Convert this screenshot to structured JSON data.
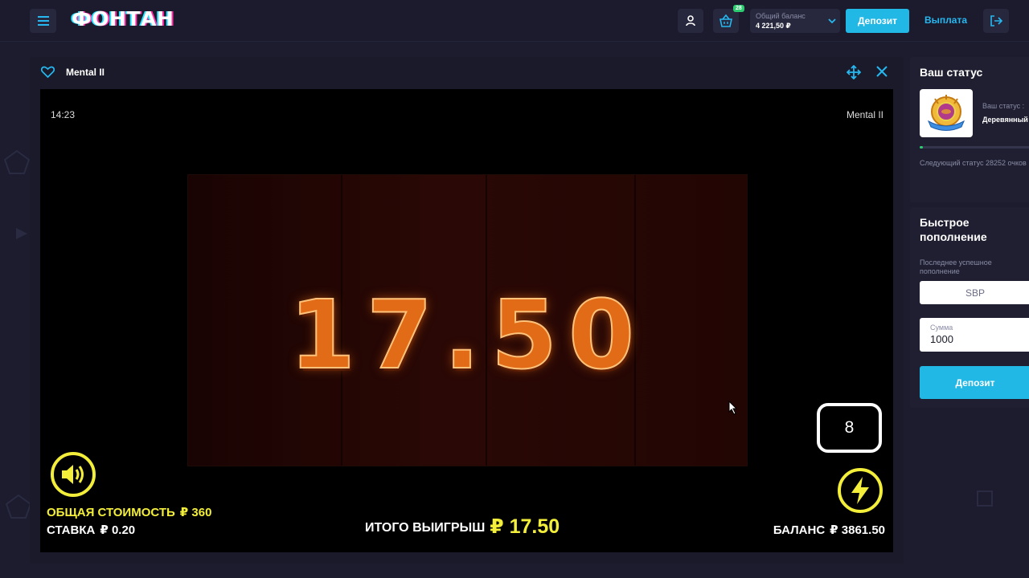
{
  "header": {
    "logo": "ФОНТАН",
    "basket_badge": "28",
    "balance_label": "Общий баланс",
    "balance_value": "4 221,50 ₽",
    "deposit_label": "Депозит",
    "withdraw_label": "Выплата"
  },
  "game": {
    "title": "Mental II",
    "time": "14:23",
    "name_right": "Mental II",
    "win_display": "17.50",
    "counter": "8",
    "total_cost_label": "ОБЩАЯ СТОИМОСТЬ",
    "total_cost_value": "₽ 360",
    "stake_label": "СТАВКА",
    "stake_value": "₽ 0.20",
    "total_win_label": "ИТОГО ВЫИГРЫШ",
    "total_win_value": "₽ 17.50",
    "balance_label": "БАЛАНС",
    "balance_value": "₽ 3861.50"
  },
  "status": {
    "title": "Ваш статус",
    "label": "Ваш статус :",
    "value": "Деревянный",
    "progress_fraction": 0.03,
    "next_status_text": "Следующий статус 28252 очков"
  },
  "topup": {
    "title": "Быстрое пополнение",
    "last_label": "Последнее успешное пополнение",
    "method": "SBP",
    "amount_label": "Сумма",
    "amount_value": "1000",
    "deposit_label": "Депозит"
  },
  "colors": {
    "accent_blue": "#22b8e6",
    "game_yellow": "#f3ee3a",
    "progress_green": "#2ecc71"
  }
}
